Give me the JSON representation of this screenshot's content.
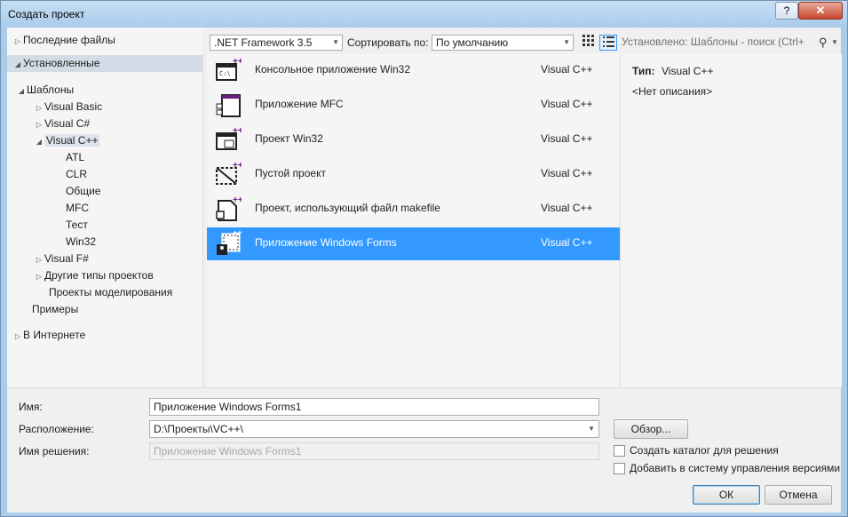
{
  "window": {
    "title": "Создать проект",
    "help_label": "?",
    "close_label": "✕"
  },
  "tree": {
    "recent": "Последние файлы",
    "installed": "Установленные",
    "templates": "Шаблоны",
    "vb": "Visual Basic",
    "csharp": "Visual C#",
    "vcpp": "Visual C++",
    "atl": "ATL",
    "clr": "CLR",
    "general": "Общие",
    "mfc": "MFC",
    "test": "Тест",
    "win32": "Win32",
    "fsharp": "Visual F#",
    "other": "Другие типы проектов",
    "modeling": "Проекты моделирования",
    "samples": "Примеры",
    "online": "В Интернете"
  },
  "toolbar": {
    "framework": ".NET Framework 3.5",
    "sort_label": "Сортировать по:",
    "sort_value": "По умолчанию",
    "search_placeholder": "Установлено: Шаблоны - поиск (Ctrl+"
  },
  "templates": [
    {
      "name": "Консольное приложение Win32",
      "lang": "Visual C++"
    },
    {
      "name": "Приложение MFC",
      "lang": "Visual C++"
    },
    {
      "name": "Проект Win32",
      "lang": "Visual C++"
    },
    {
      "name": "Пустой проект",
      "lang": "Visual C++"
    },
    {
      "name": "Проект, использующий файл makefile",
      "lang": "Visual C++"
    },
    {
      "name": "Приложение Windows Forms",
      "lang": "Visual C++"
    }
  ],
  "details": {
    "type_label": "Тип:",
    "type_value": "Visual C++",
    "description": "<Нет описания>"
  },
  "form": {
    "name_label": "Имя:",
    "name_value": "Приложение Windows Forms1",
    "location_label": "Расположение:",
    "location_value": "D:\\Проекты\\VC++\\",
    "solution_label": "Имя решения:",
    "solution_value": "Приложение Windows Forms1",
    "browse": "Обзор...",
    "create_dir": "Создать каталог для решения",
    "add_vcs": "Добавить в систему управления версиями",
    "ok": "ОК",
    "cancel": "Отмена"
  },
  "colors": {
    "accent": "#3399ff",
    "vcpp": "#68217a"
  }
}
